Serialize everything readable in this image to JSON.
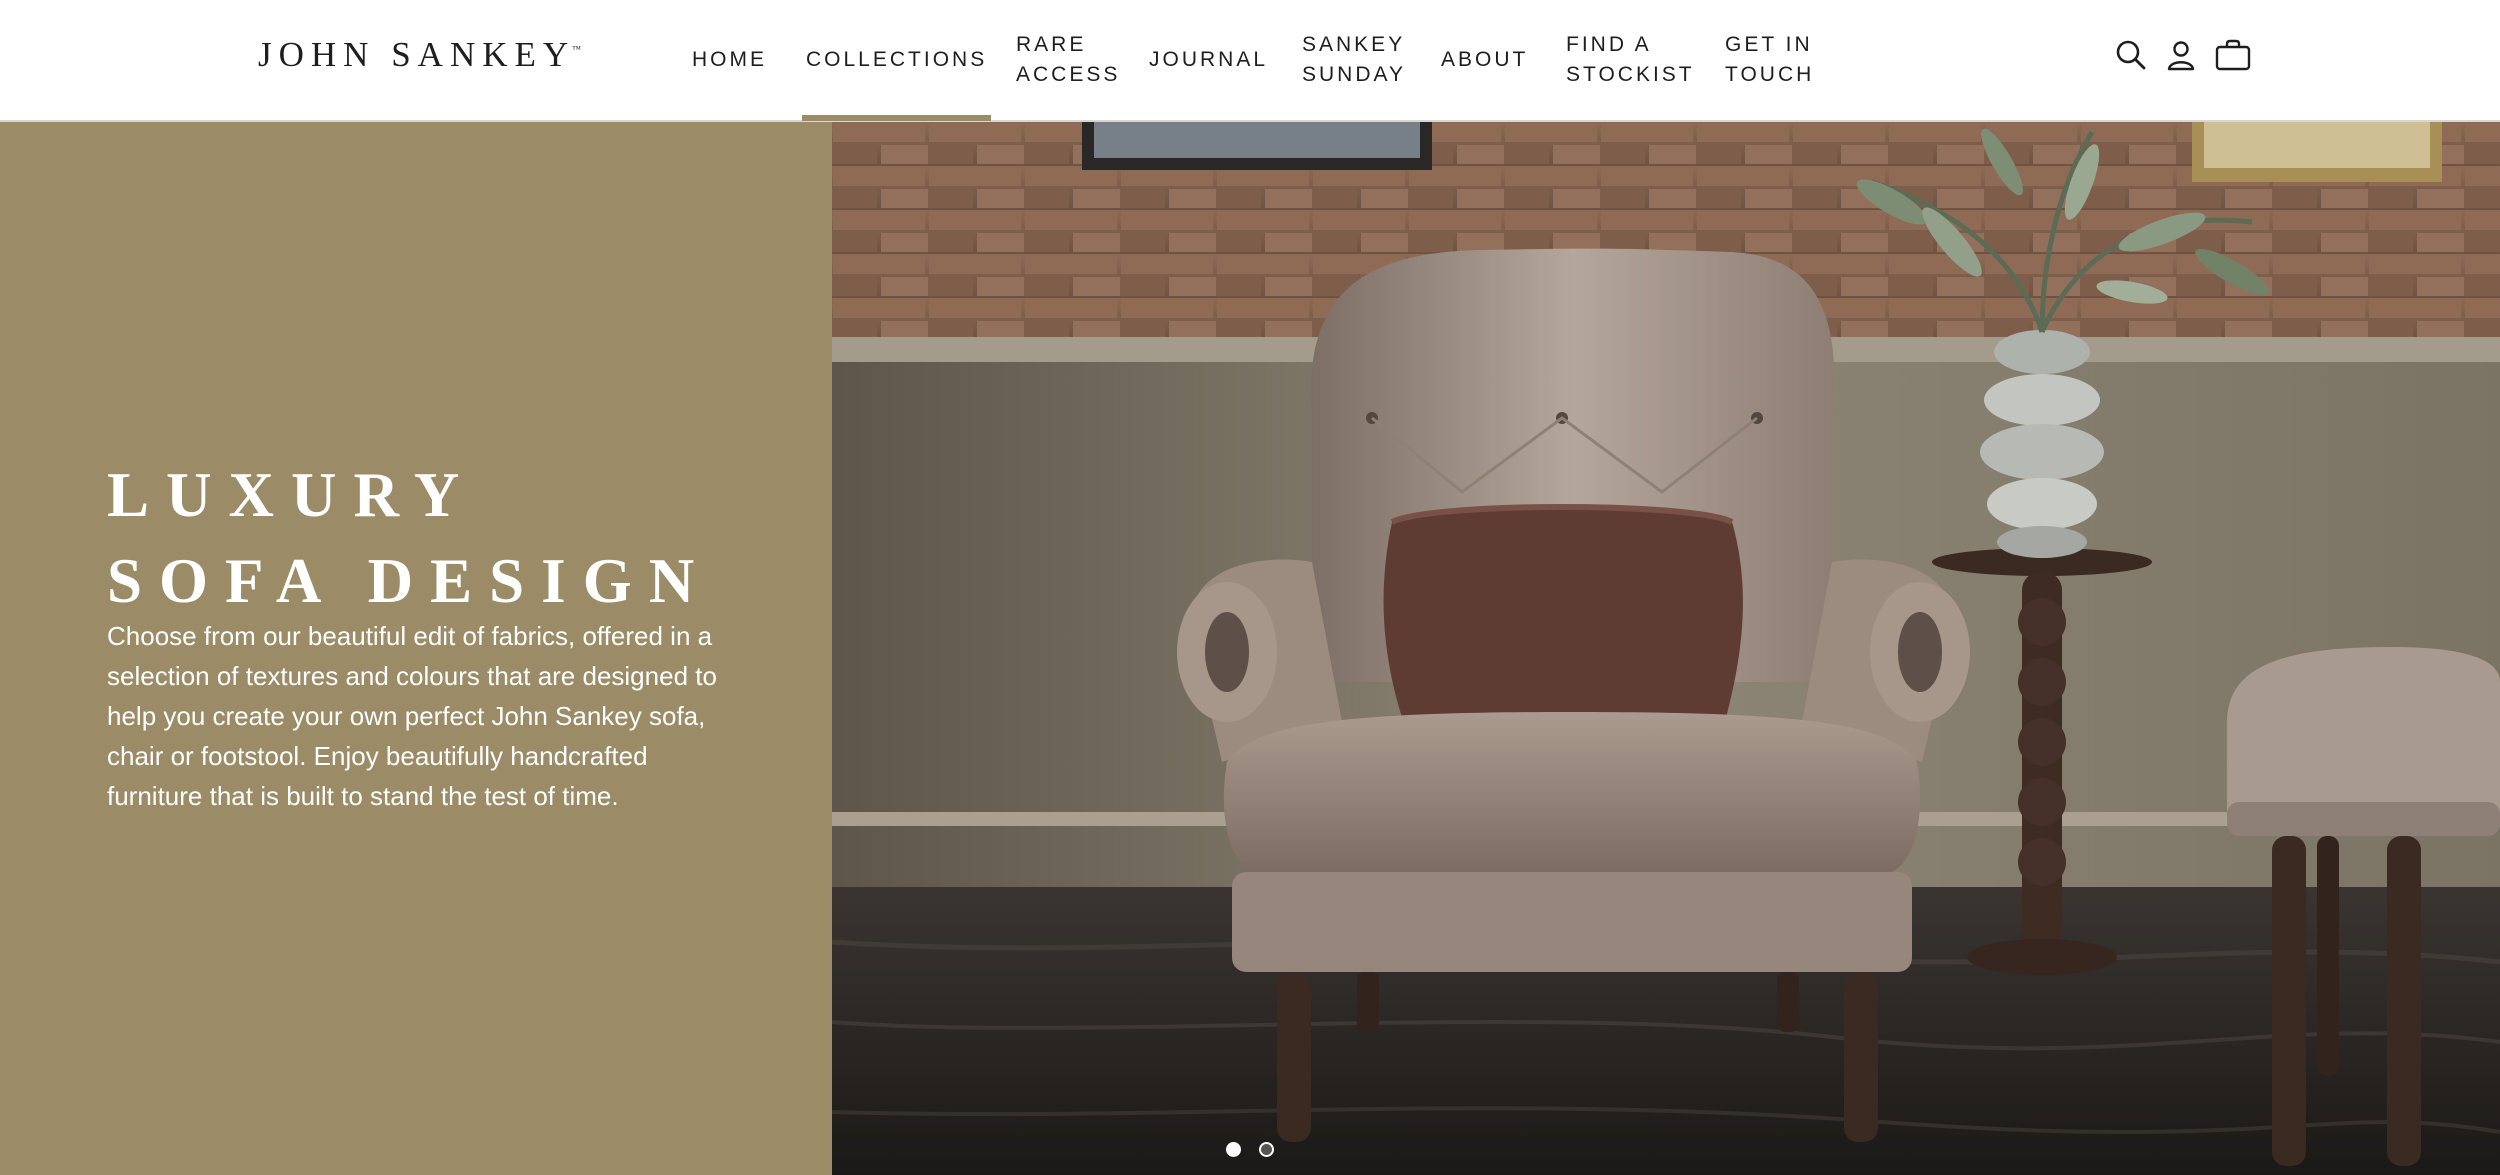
{
  "brand": {
    "name": "JOHN SANKEY",
    "trademark": "™"
  },
  "nav": {
    "items": [
      {
        "label": "HOME",
        "active": false
      },
      {
        "label": "COLLECTIONS",
        "active": true
      },
      {
        "label": "RARE\nACCESS",
        "active": false
      },
      {
        "label": "JOURNAL",
        "active": false
      },
      {
        "label": "SANKEY\nSUNDAY",
        "active": false
      },
      {
        "label": "ABOUT",
        "active": false
      },
      {
        "label": "FIND A\nSTOCKIST",
        "active": false
      },
      {
        "label": "GET IN\nTOUCH",
        "active": false
      }
    ]
  },
  "header_icons": [
    "search-icon",
    "account-icon",
    "bag-icon"
  ],
  "hero": {
    "title_line1": "LUXURY",
    "title_line2": "SOFA DESIGN",
    "copy": "Choose from our beautiful edit of fabrics, offered in a selection of textures and colours that are designed to help you create your own perfect John Sankey sofa, chair or footstool. Enjoy beautifully handcrafted furniture that is built to stand the test of time.",
    "image_subject": "armchair-photo"
  },
  "carousel": {
    "slide_count": 2,
    "active_slide": 1
  },
  "colors": {
    "accent": "#9b8b66",
    "header_bg": "#ffffff",
    "text_dark": "#1e1e1e",
    "hero_text": "#ffffff"
  }
}
